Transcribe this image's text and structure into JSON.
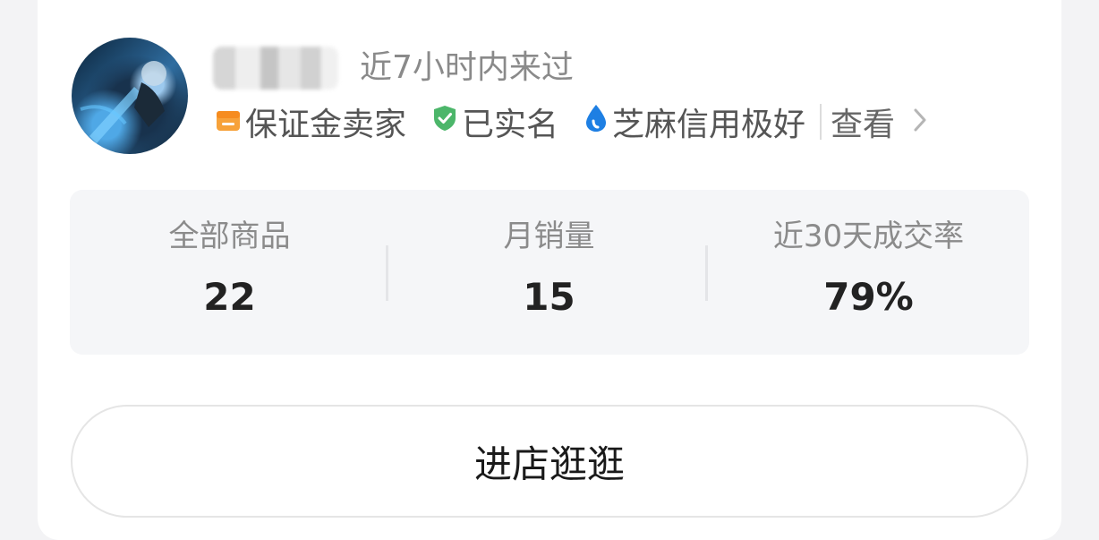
{
  "seller": {
    "last_visit": "近7小时内来过",
    "badges": [
      {
        "icon": "deposit-seller-icon",
        "label": "保证金卖家",
        "color": "#f7a23a"
      },
      {
        "icon": "verified-shield-icon",
        "label": "已实名",
        "color": "#4cb66a"
      },
      {
        "icon": "sesame-credit-icon",
        "label": "芝麻信用极好",
        "color": "#1e7fe3"
      }
    ],
    "view_label": "查看"
  },
  "stats": [
    {
      "label": "全部商品",
      "value": "22"
    },
    {
      "label": "月销量",
      "value": "15"
    },
    {
      "label": "近30天成交率",
      "value": "79%"
    }
  ],
  "shop_button": {
    "label": "进店逛逛"
  }
}
